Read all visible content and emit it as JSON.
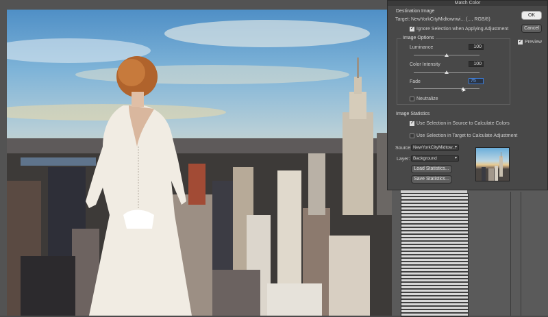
{
  "dialog": {
    "title": "Match Color",
    "ok_label": "OK",
    "cancel_label": "Cancel",
    "preview_label": "Preview",
    "preview_checked": true
  },
  "destination": {
    "group_title": "Destination Image",
    "target_label": "Target:",
    "target_value": "NewYorkCityMidtownwi... (..., RGB/8)",
    "ignore_selection_label": "Ignore Selection when Applying Adjustment",
    "ignore_selection_checked": true
  },
  "image_options": {
    "group_title": "Image Options",
    "luminance_label": "Luminance",
    "luminance_value": "100",
    "luminance_level": 0.5,
    "color_intensity_label": "Color Intensity",
    "color_intensity_value": "100",
    "color_intensity_level": 0.5,
    "fade_label": "Fade",
    "fade_value": "75",
    "fade_level": 0.75,
    "neutralize_label": "Neutralize",
    "neutralize_checked": false
  },
  "statistics": {
    "group_title": "Image Statistics",
    "use_source_label": "Use Selection in Source to Calculate Colors",
    "use_source_checked": true,
    "use_target_label": "Use Selection in Target to Calculate Adjustment",
    "use_target_checked": false,
    "source_label": "Source:",
    "source_value": "NewYorkCityMidtow...",
    "layer_label": "Layer:",
    "layer_value": "Background",
    "load_label": "Load Statistics...",
    "save_label": "Save Statistics..."
  },
  "icons": {
    "dropdown": "chevron-down-icon",
    "cursor": "pointer-cursor-icon"
  }
}
